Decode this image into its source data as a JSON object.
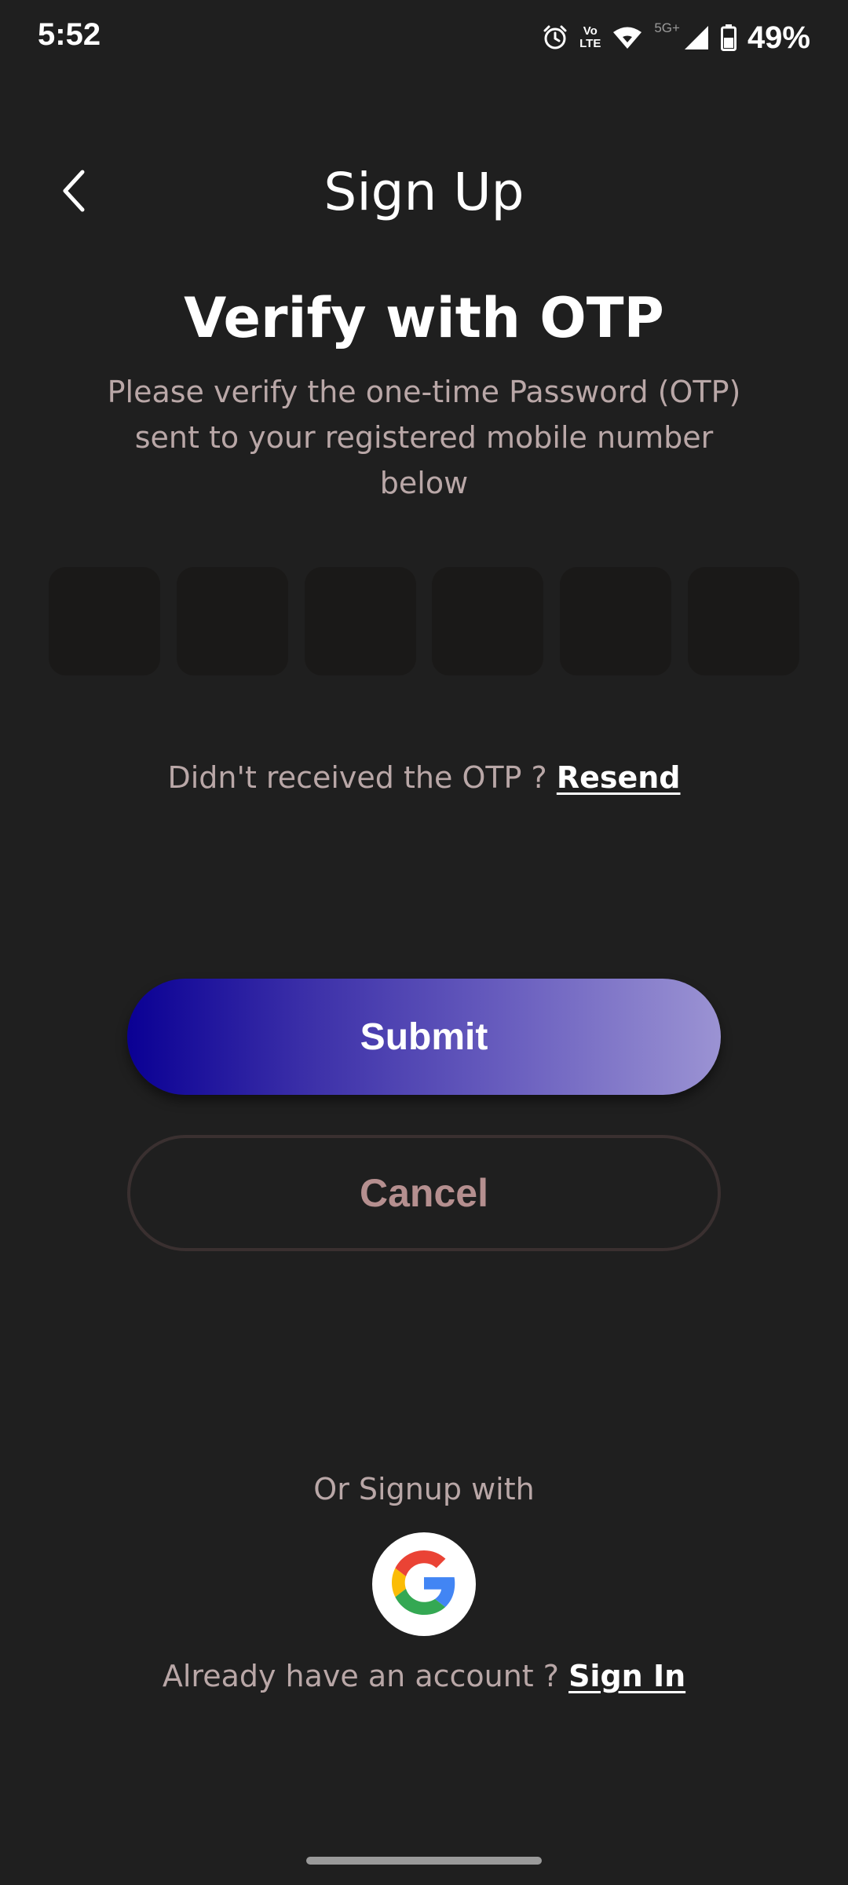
{
  "status_bar": {
    "time": "5:52",
    "lte_top": "Vo",
    "lte_bottom": "LTE",
    "network": "5G+",
    "battery": "49%",
    "icons": [
      "alarm-icon",
      "volte-icon",
      "wifi-icon",
      "signal-icon",
      "battery-icon"
    ]
  },
  "header": {
    "back_icon": "chevron-left-icon",
    "title": "Sign Up"
  },
  "main": {
    "heading": "Verify with OTP",
    "description": "Please verify the one-time Password (OTP) sent to your registered mobile number below",
    "otp_fields": [
      "",
      "",
      "",
      "",
      "",
      ""
    ],
    "resend_prompt": "Didn't received the OTP ?",
    "resend_link": "Resend",
    "submit_label": "Submit",
    "cancel_label": "Cancel"
  },
  "footer": {
    "or_signup": "Or Signup with",
    "google_icon": "google-icon",
    "signin_prompt": "Already have an account ?",
    "signin_link": "Sign In"
  },
  "colors": {
    "background": "#1f1f1f",
    "otp_box": "#1a1918",
    "muted_text": "#b9a7a7",
    "submit_gradient_start": "#0a0094",
    "submit_gradient_end": "#9b93d3",
    "cancel_text": "#b58f8f"
  }
}
